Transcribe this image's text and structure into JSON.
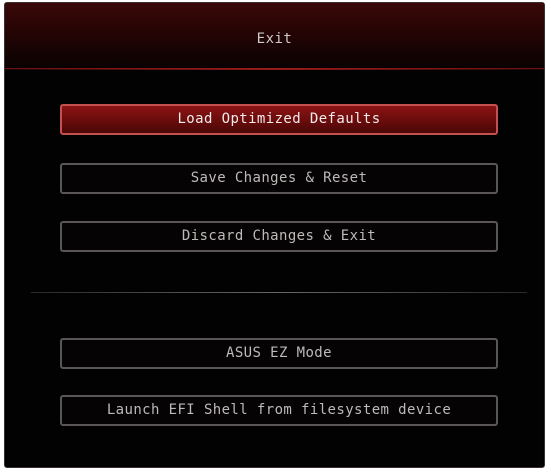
{
  "dialog": {
    "title": "Exit"
  },
  "options": {
    "load_defaults": "Load Optimized Defaults",
    "save_reset": "Save Changes & Reset",
    "discard_exit": "Discard Changes & Exit",
    "ez_mode": "ASUS EZ Mode",
    "efi_shell": "Launch EFI Shell from filesystem device"
  },
  "colors": {
    "accent": "#8a1414",
    "selected_border": "#c45050",
    "background": "#030202"
  }
}
